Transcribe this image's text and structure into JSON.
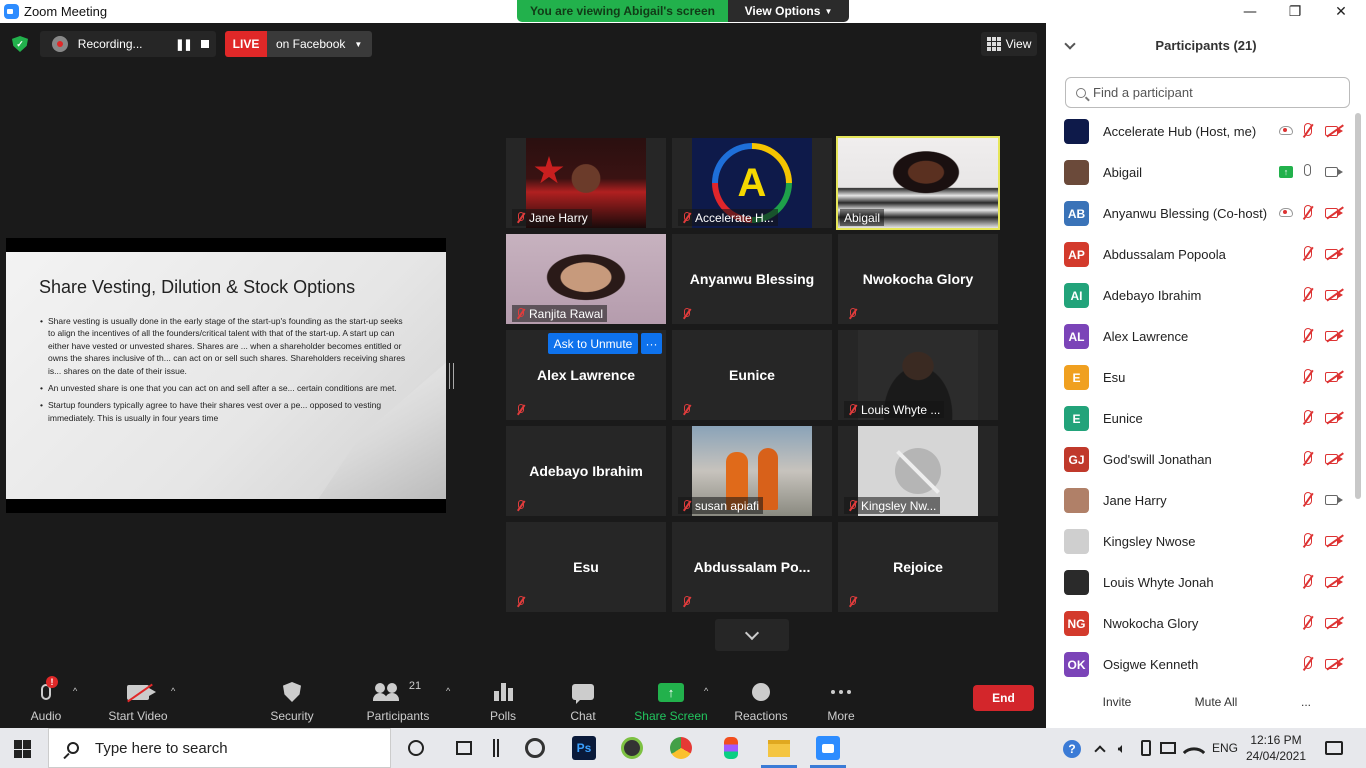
{
  "window": {
    "title": "Zoom Meeting",
    "minimize": "—",
    "maximize": "❐",
    "close": "✕"
  },
  "banner": {
    "message": "You are viewing Abigail's screen",
    "view_options": "View Options"
  },
  "top_bar": {
    "recording_label": "Recording...",
    "pause_label": "❚❚",
    "live_label": "LIVE",
    "live_destination": "on Facebook",
    "view_label": "View"
  },
  "shared_slide": {
    "title": "Share Vesting, Dilution & Stock Options",
    "bullets": [
      "Share vesting is usually done in the early stage of the start-up's founding as the start-up seeks to align the incentives of all the founders/critical talent with that of the start-up. A start up can either have vested or unvested shares. Shares are ... when a shareholder becomes entitled or owns the shares inclusive of th... can act on or sell such shares. Shareholders receiving shares is... shares on the date of their issue.",
      "An unvested share is one that you can act on and sell after a se... certain conditions are met.",
      "Startup founders typically agree to have their shares vest over a pe... opposed to vesting immediately. This is usually in four years time"
    ]
  },
  "video_tiles": [
    {
      "name": "Jane Harry",
      "has_video": true
    },
    {
      "name": "Accelerate H...",
      "has_video": true
    },
    {
      "name": "Abigail",
      "has_video": true,
      "active_speaker": true
    },
    {
      "name": "Ranjita Rawal",
      "has_video": true
    },
    {
      "name": "Anyanwu Blessing",
      "has_video": false
    },
    {
      "name": "Nwokocha Glory",
      "has_video": false
    },
    {
      "name": "Alex Lawrence",
      "has_video": false
    },
    {
      "name": "Eunice",
      "has_video": false
    },
    {
      "name": "Louis Whyte ...",
      "has_video": true
    },
    {
      "name": "Adebayo Ibrahim",
      "has_video": false
    },
    {
      "name": "susan apiafi",
      "has_video": true
    },
    {
      "name": "Kingsley Nw...",
      "has_video": true
    },
    {
      "name": "Esu",
      "has_video": false
    },
    {
      "name": "Abdussalam  Po...",
      "has_video": false
    },
    {
      "name": "Rejoice",
      "has_video": false
    }
  ],
  "hover_actions": {
    "ask_to_unmute": "Ask to Unmute",
    "more": "···"
  },
  "logo_letter": "A",
  "toolbar": {
    "audio": "Audio",
    "audio_badge": "!",
    "start_video": "Start Video",
    "security": "Security",
    "participants": "Participants",
    "participants_count": "21",
    "polls": "Polls",
    "chat": "Chat",
    "share_screen": "Share Screen",
    "reactions": "Reactions",
    "more": "More",
    "end": "End",
    "caret": "^"
  },
  "participants_panel": {
    "title": "Participants (21)",
    "search_placeholder": "Find a participant",
    "participants": [
      {
        "name": "Accelerate Hub (Host, me)",
        "initials": "",
        "avatar_color": "#0e1a4a",
        "status": "cloud-rec,mic-muted,cam-off"
      },
      {
        "name": "Abigail",
        "initials": "",
        "avatar_color": "#6b4a3a",
        "status": "sharing,mic-on,cam-on"
      },
      {
        "name": "Anyanwu Blessing (Co-host)",
        "initials": "AB",
        "avatar_color": "#3a73b8",
        "status": "cloud-rec,mic-muted,cam-off"
      },
      {
        "name": "Abdussalam Popoola",
        "initials": "AP",
        "avatar_color": "#d33a2c",
        "status": "mic-muted,cam-off"
      },
      {
        "name": "Adebayo Ibrahim",
        "initials": "AI",
        "avatar_color": "#22a37a",
        "status": "mic-muted,cam-off"
      },
      {
        "name": "Alex Lawrence",
        "initials": "AL",
        "avatar_color": "#7b44b8",
        "status": "mic-muted,cam-off"
      },
      {
        "name": "Esu",
        "initials": "E",
        "avatar_color": "#f0a020",
        "status": "mic-muted,cam-off"
      },
      {
        "name": "Eunice",
        "initials": "E",
        "avatar_color": "#22a37a",
        "status": "mic-muted,cam-off"
      },
      {
        "name": "God'swill Jonathan",
        "initials": "GJ",
        "avatar_color": "#c0392b",
        "status": "mic-muted,cam-off"
      },
      {
        "name": "Jane Harry",
        "initials": "",
        "avatar_color": "#b08068",
        "status": "mic-muted,cam-on"
      },
      {
        "name": "Kingsley Nwose",
        "initials": "",
        "avatar_color": "#cfcfcf",
        "status": "mic-muted,cam-off"
      },
      {
        "name": "Louis Whyte Jonah",
        "initials": "",
        "avatar_color": "#2a2a2a",
        "status": "mic-muted,cam-off"
      },
      {
        "name": "Nwokocha Glory",
        "initials": "NG",
        "avatar_color": "#d33a2c",
        "status": "mic-muted,cam-off"
      },
      {
        "name": "Osigwe Kenneth",
        "initials": "OK",
        "avatar_color": "#7b44b8",
        "status": "mic-muted,cam-off"
      }
    ],
    "invite": "Invite",
    "mute_all": "Mute All",
    "more": "..."
  },
  "taskbar": {
    "search_placeholder": "Type here to search",
    "language": "ENG",
    "time": "12:16 PM",
    "date": "24/04/2021"
  }
}
